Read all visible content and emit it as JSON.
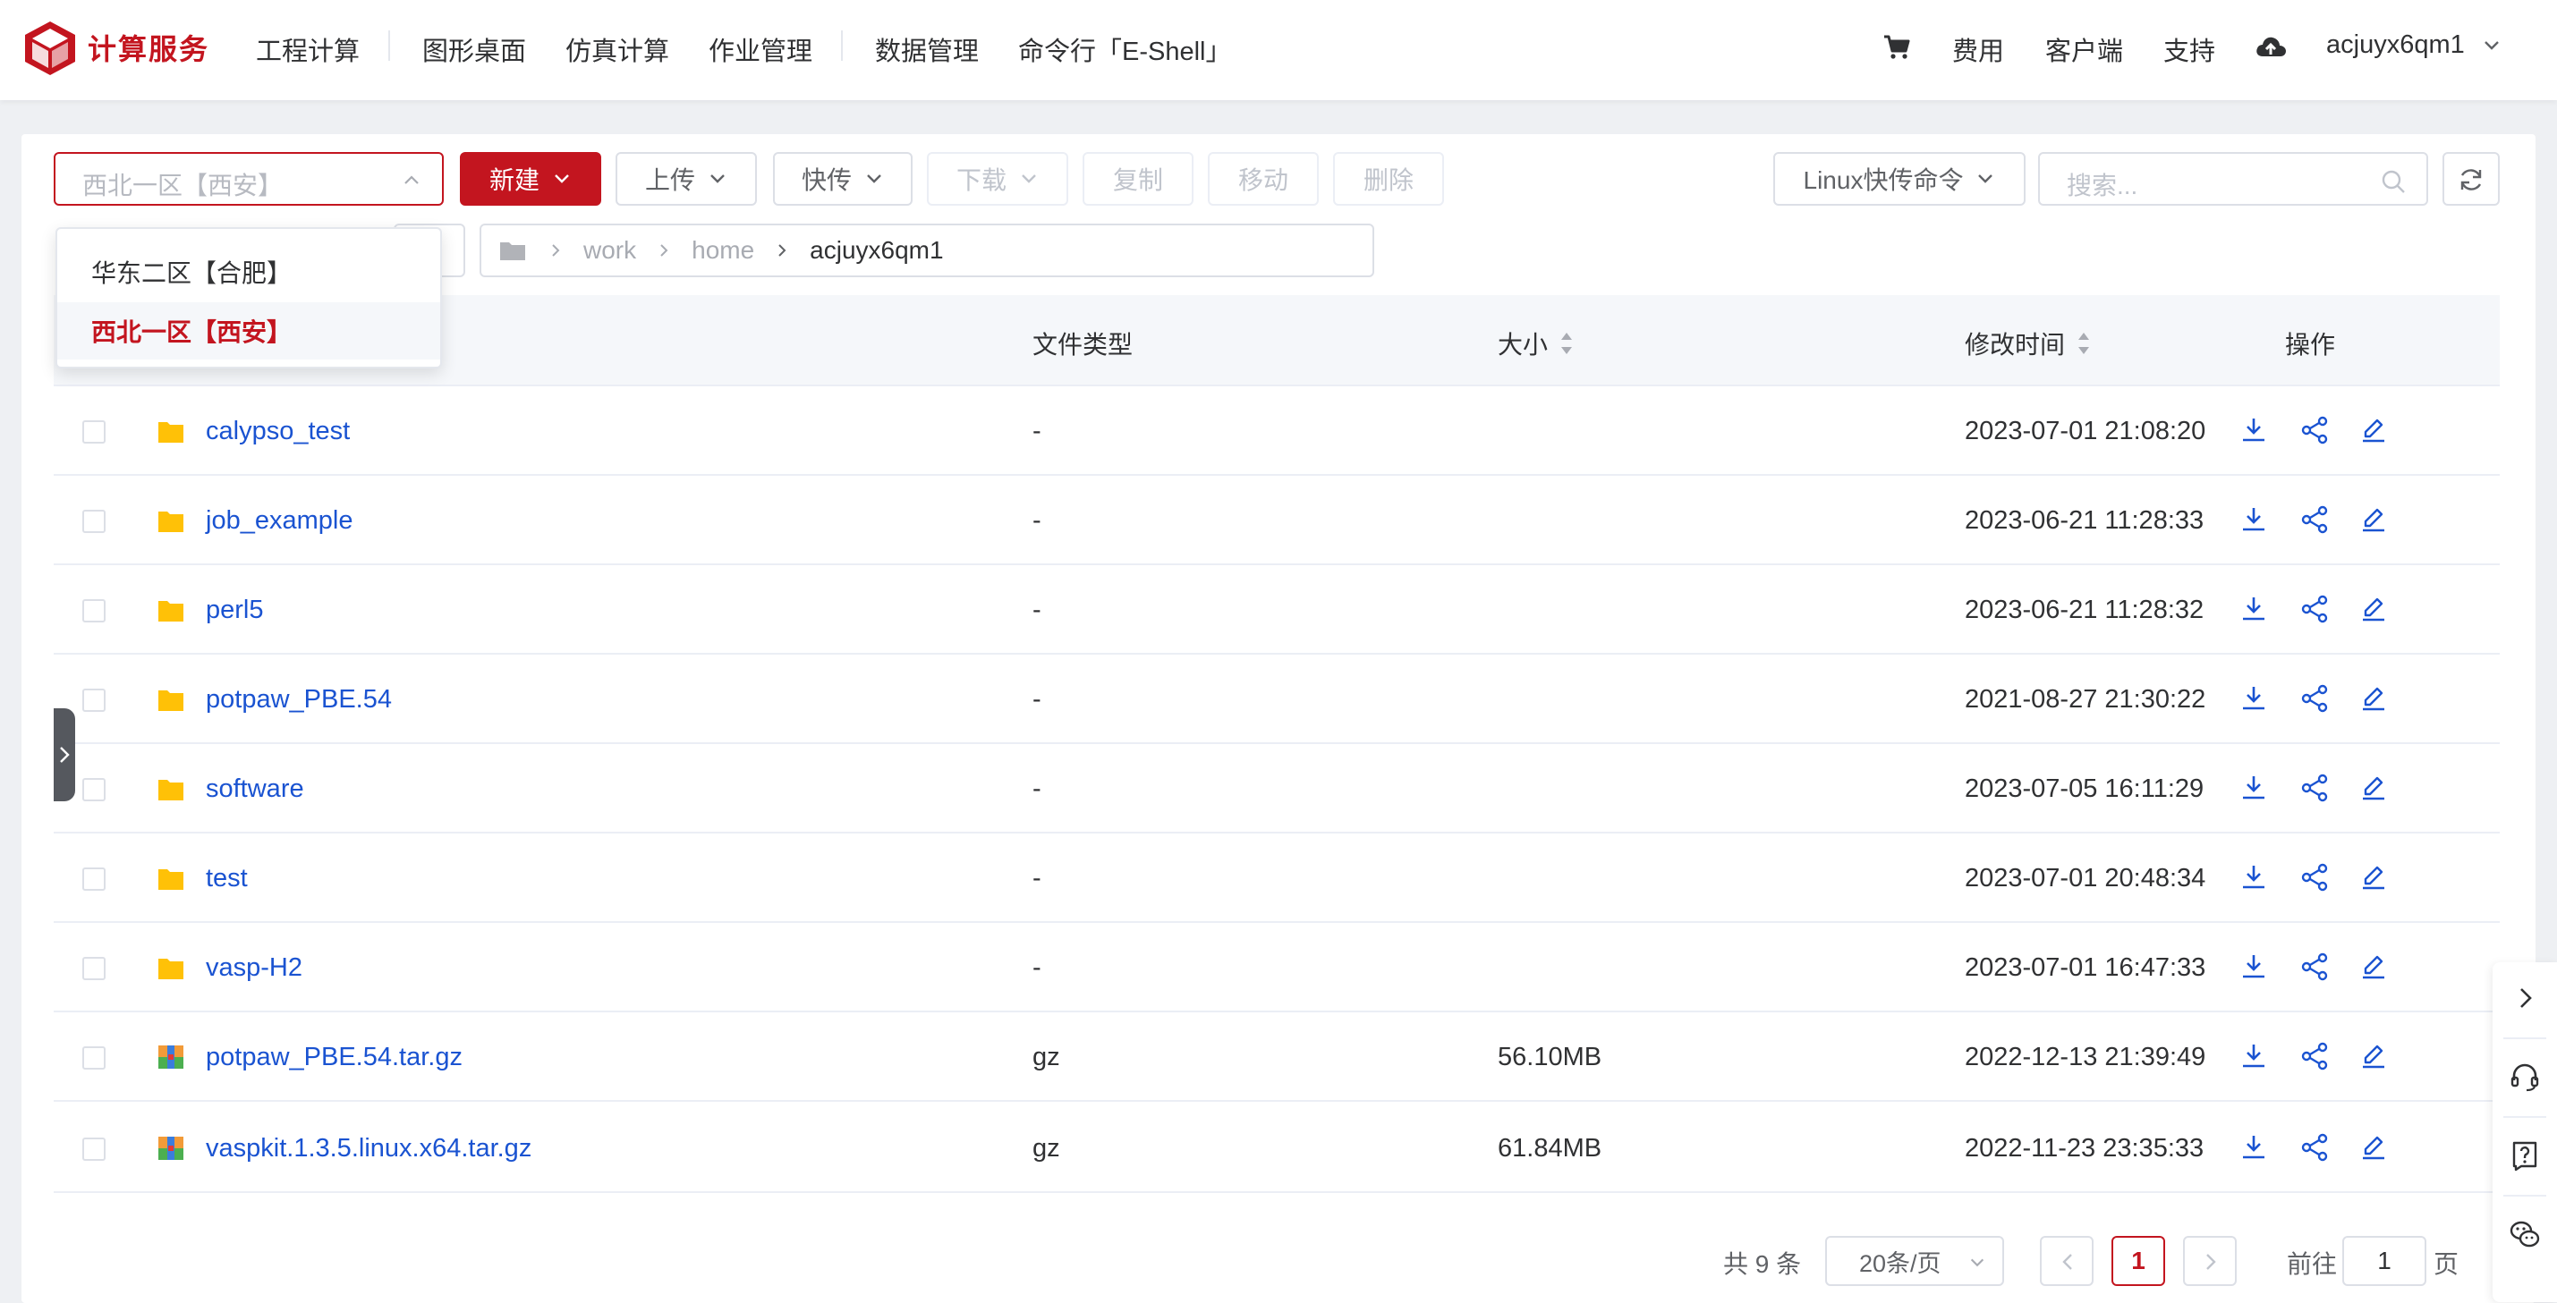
{
  "brand": {
    "name": "计算服务",
    "color": "#c3151f"
  },
  "nav": {
    "items": [
      "工程计算",
      "图形桌面",
      "仿真计算",
      "作业管理",
      "数据管理",
      "命令行「E-Shell」"
    ]
  },
  "top_right": {
    "fees": "费用",
    "client": "客户端",
    "support": "支持",
    "username": "acjuyx6qm1"
  },
  "toolbar": {
    "region_placeholder": "西北一区【西安】",
    "new_label": "新建",
    "upload_label": "上传",
    "fast_transfer_label": "快传",
    "download_label": "下载",
    "copy_label": "复制",
    "move_label": "移动",
    "delete_label": "删除",
    "linux_cmd_label": "Linux快传命令",
    "search_placeholder": "搜索..."
  },
  "region_dropdown": {
    "options": [
      "华东二区【合肥】",
      "西北一区【西安】"
    ],
    "selected": "西北一区【西安】"
  },
  "breadcrumb": {
    "segments": [
      "work",
      "home",
      "acjuyx6qm1"
    ]
  },
  "table": {
    "headers": {
      "type": "文件类型",
      "size": "大小",
      "modified": "修改时间",
      "actions": "操作"
    },
    "rows": [
      {
        "name": "calypso_test",
        "kind": "folder",
        "type": "-",
        "size": "",
        "modified": "2023-07-01 21:08:20"
      },
      {
        "name": "job_example",
        "kind": "folder",
        "type": "-",
        "size": "",
        "modified": "2023-06-21 11:28:33"
      },
      {
        "name": "perl5",
        "kind": "folder",
        "type": "-",
        "size": "",
        "modified": "2023-06-21 11:28:32"
      },
      {
        "name": "potpaw_PBE.54",
        "kind": "folder",
        "type": "-",
        "size": "",
        "modified": "2021-08-27 21:30:22"
      },
      {
        "name": "software",
        "kind": "folder",
        "type": "-",
        "size": "",
        "modified": "2023-07-05 16:11:29"
      },
      {
        "name": "test",
        "kind": "folder",
        "type": "-",
        "size": "",
        "modified": "2023-07-01 20:48:34"
      },
      {
        "name": "vasp-H2",
        "kind": "folder",
        "type": "-",
        "size": "",
        "modified": "2023-07-01 16:47:33"
      },
      {
        "name": "potpaw_PBE.54.tar.gz",
        "kind": "archive",
        "type": "gz",
        "size": "56.10MB",
        "modified": "2022-12-13 21:39:49"
      },
      {
        "name": "vaspkit.1.3.5.linux.x64.tar.gz",
        "kind": "archive",
        "type": "gz",
        "size": "61.84MB",
        "modified": "2022-11-23 23:35:33"
      }
    ]
  },
  "pagination": {
    "total": "共 9 条",
    "page_size": "20条/页",
    "current_page": "1",
    "goto_label": "前往",
    "goto_value": "1",
    "page_suffix": "页"
  },
  "colors": {
    "accent": "#c3151f",
    "link": "#1a53d1",
    "folder": "#ffc107"
  }
}
